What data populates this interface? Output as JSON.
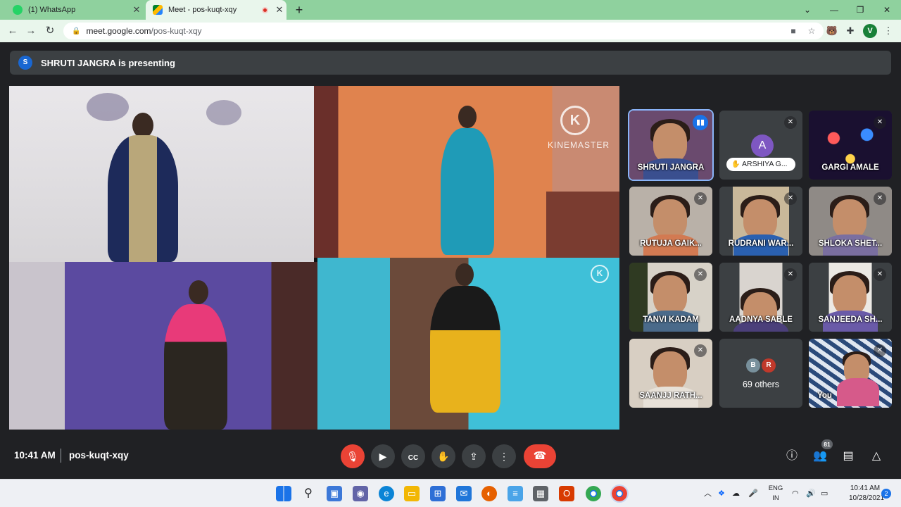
{
  "browser": {
    "tabs": [
      {
        "title": "(1) WhatsApp",
        "favicon": "whatsapp-icon"
      },
      {
        "title": "Meet - pos-kuqt-xqy",
        "favicon": "google-meet-icon",
        "recording": true
      }
    ],
    "url_host": "meet.google.com",
    "url_path": "/pos-kuqt-xqy",
    "profile_initial": "V",
    "accent": "#8fd19e"
  },
  "meet": {
    "presenter_initial": "S",
    "presenting_text": "SHRUTI JANGRA is presenting",
    "participants": [
      {
        "name": "SHRUTI JANGRA",
        "speaking": true
      },
      {
        "name": "ARSHIYA G...",
        "initial": "A",
        "hand_raised": true,
        "muted": true
      },
      {
        "name": "GARGI AMALE",
        "muted": true
      },
      {
        "name": "RUTUJA GAIK...",
        "muted": true
      },
      {
        "name": "RUDRANI WAR...",
        "muted": true
      },
      {
        "name": "SHLOKA SHET...",
        "muted": true
      },
      {
        "name": "TANVI KADAM",
        "muted": true
      },
      {
        "name": "AADNYA SABLE",
        "muted": true
      },
      {
        "name": "SANJEEDA SH...",
        "muted": true
      },
      {
        "name": "SAANJJ RATH...",
        "muted": true
      },
      {
        "name": "You",
        "muted": true
      }
    ],
    "others": {
      "avatars": [
        "B",
        "R"
      ],
      "label": "69 others"
    },
    "watermark": "KINEMASTER",
    "watermark_logo": "K",
    "participants_count": "81"
  },
  "controls": {
    "time": "10:41 AM",
    "meeting_code": "pos-kuqt-xqy",
    "end_color": "#ea4335"
  },
  "taskbar": {
    "lang_top": "ENG",
    "lang_bottom": "IN",
    "clock_time": "10:41 AM",
    "clock_date": "10/28/2021",
    "notification_count": "2"
  }
}
